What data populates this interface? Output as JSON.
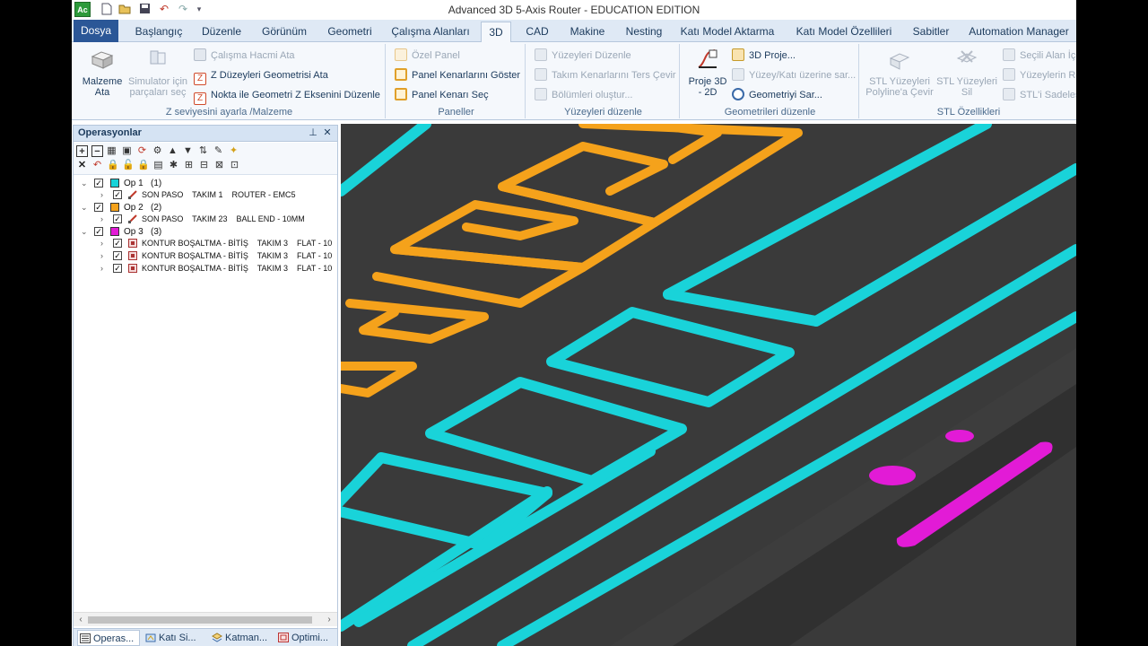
{
  "window": {
    "title": "Advanced 3D 5-Axis Router - EDUCATION EDITION",
    "logo": "Ac"
  },
  "quick_access": [
    "new-icon",
    "open-icon",
    "save-icon",
    "undo-icon",
    "redo-icon",
    "customize-icon"
  ],
  "tabs": [
    {
      "label": "Dosya"
    },
    {
      "label": "Başlangıç"
    },
    {
      "label": "Düzenle"
    },
    {
      "label": "Görünüm"
    },
    {
      "label": "Geometri"
    },
    {
      "label": "Çalışma Alanları"
    },
    {
      "label": "3D"
    },
    {
      "label": "CAD"
    },
    {
      "label": "Makine"
    },
    {
      "label": "Nesting"
    },
    {
      "label": "Katı Model Aktarma"
    },
    {
      "label": "Katı Model Özellileri"
    },
    {
      "label": "Sabitler"
    },
    {
      "label": "Automation Manager"
    }
  ],
  "ribbon": {
    "group1": {
      "label": "Z seviyesini ayarla /Malzeme",
      "btn_malzeme_l1": "Malzeme",
      "btn_malzeme_l2": "Ata",
      "btn_sim_l1": "Simulator için",
      "btn_sim_l2": "parçaları seç",
      "calisma_hacmi": "Çalışma Hacmi Ata",
      "z_duzeyleri": "Z Düzeyleri Geometrisi Ata",
      "nokta_ile": "Nokta ile Geometri Z Eksenini Düzenle"
    },
    "group2": {
      "label": "Paneller",
      "ozel_panel": "Özel Panel",
      "panel_kenar_goster": "Panel Kenarlarını Göster",
      "panel_kenari_sec": "Panel Kenarı Seç"
    },
    "group3": {
      "label": "Yüzeyleri düzenle",
      "yuzeyleri_duzenle": "Yüzeyleri Düzenle",
      "takim_kenarlari": "Takım Kenarlarını Ters Çevir",
      "bolumleri": "Bölümleri oluştur..."
    },
    "group4": {
      "label": "Geometrileri düzenle",
      "proje_l1": "Proje 3D",
      "proje_l2": "- 2D",
      "proje_3d": "3D Proje...",
      "yuzey_kati": "Yüzey/Katı üzerine sar...",
      "geometriyi_sar": "Geometriyi Sar..."
    },
    "group5": {
      "label": "STL Özellikleri",
      "stl_polyline_l1": "STL Yüzeyleri",
      "stl_polyline_l2": "Polyline'a Çevir",
      "stl_sil_l1": "STL Yüzeyleri",
      "stl_sil_l2": "Sil",
      "secili_alan": "Seçili Alan İçe",
      "yuzeylerin_re": "Yüzeylerin Re",
      "stl_sadeles": "STL'i Sadeleş"
    }
  },
  "ops_panel": {
    "title": "Operasyonlar",
    "pin_icon": "pin-icon",
    "close_icon": "close-icon",
    "tree": [
      {
        "label": "Op 1",
        "count": "(1)",
        "color": "#19d3d9",
        "children": [
          {
            "text": "SON PASO    TAKIM 1    ROUTER - EMC5"
          }
        ]
      },
      {
        "label": "Op 2",
        "count": "(2)",
        "color": "#f5a21b",
        "children": [
          {
            "text": "SON PASO    TAKIM 23    BALL END - 10MM"
          }
        ]
      },
      {
        "label": "Op 3",
        "count": "(3)",
        "color": "#e21bd6",
        "children": [
          {
            "text": "KONTUR BOŞALTMA - BİTİŞ    TAKIM 3    FLAT - 10"
          },
          {
            "text": "KONTUR BOŞALTMA - BİTİŞ    TAKIM 3    FLAT - 10"
          },
          {
            "text": "KONTUR BOŞALTMA - BİTİŞ    TAKIM 3    FLAT - 10"
          }
        ]
      }
    ],
    "bottom_tabs": [
      {
        "label": "Operas..."
      },
      {
        "label": "Katı Si..."
      },
      {
        "label": "Katman..."
      },
      {
        "label": "Optimi..."
      }
    ]
  },
  "colors": {
    "cyan_toolpath": "#19d3d9",
    "orange_toolpath": "#f5a21b",
    "magenta_toolpath": "#e21bd6",
    "viewport_bg": "#3a3a3a",
    "ribbon_bg": "#f5f8fc",
    "file_tab": "#2b5797"
  }
}
